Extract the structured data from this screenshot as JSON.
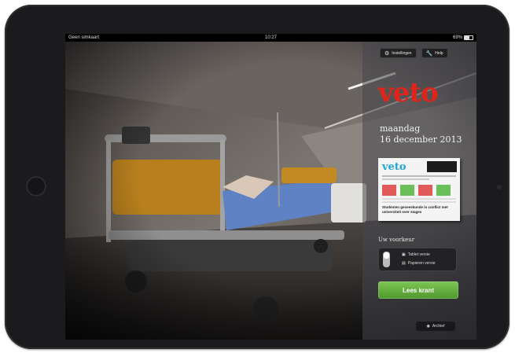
{
  "status_bar": {
    "carrier": "Geen simkaart",
    "time": "10:27",
    "battery": "69%"
  },
  "panel": {
    "settings_label": "Instellingen",
    "help_label": "Help",
    "logo": "veto",
    "day": "maandag",
    "date": "16 december 2013",
    "newspaper_thumb": {
      "logo": "veto",
      "headline": "Studenten geneeskunde in conflict met universiteit over stages"
    },
    "version_title": "Uw voorkeur",
    "option_tablet": "Tablet versie",
    "option_paper": "Papieren versie",
    "read_button": "Lees krant",
    "archive_button": "Archief"
  },
  "icons": {
    "settings": "gear-icon",
    "help": "wrench-icon",
    "archive": "archive-icon",
    "switch": "toggle-switch",
    "battery": "battery-icon"
  },
  "colors": {
    "logo_red": "#e2231a",
    "button_green": "#5aa936",
    "thumb_blue": "#1ea6d8"
  }
}
